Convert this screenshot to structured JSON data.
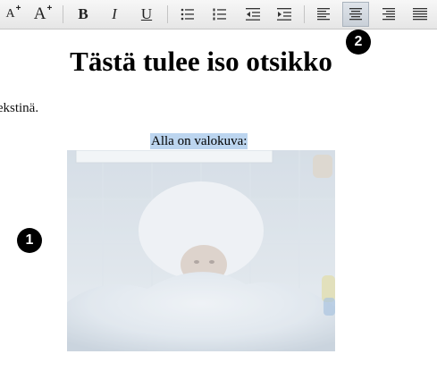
{
  "toolbar": {
    "buttons": [
      {
        "name": "font-size-decrease",
        "label": "A"
      },
      {
        "name": "font-size-increase",
        "label": "A"
      },
      {
        "name": "bold",
        "label": "B"
      },
      {
        "name": "italic",
        "label": "I"
      },
      {
        "name": "underline",
        "label": "U"
      },
      {
        "name": "bulleted-list",
        "label": ""
      },
      {
        "name": "numbered-list",
        "label": ""
      },
      {
        "name": "outdent",
        "label": ""
      },
      {
        "name": "indent",
        "label": ""
      },
      {
        "name": "align-left",
        "label": ""
      },
      {
        "name": "align-center",
        "label": "",
        "active": true
      },
      {
        "name": "align-right",
        "label": ""
      },
      {
        "name": "align-justify",
        "label": ""
      }
    ]
  },
  "document": {
    "heading": "Tästä tulee iso otsikko",
    "body_text": "ätekstinä.",
    "caption": "Alla on valokuva:",
    "photo": {
      "description_icon": "bath-foam-photo"
    }
  },
  "annotations": {
    "badge_1": "1",
    "badge_2": "2"
  },
  "colors": {
    "toolbar_bg": "#eeeeee",
    "selection": "#bcd5ef",
    "badge": "#000000"
  }
}
